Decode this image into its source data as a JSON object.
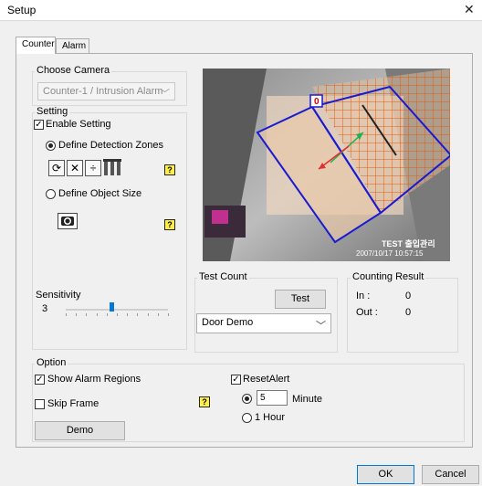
{
  "window": {
    "title": "Setup",
    "close_glyph": "✕"
  },
  "tabs": [
    {
      "label": "Counter"
    },
    {
      "label": "Alarm"
    }
  ],
  "choose_camera": {
    "legend": "Choose Camera",
    "value": "Counter-1 / Intrusion Alarm"
  },
  "setting": {
    "legend": "Setting",
    "enable_label": "Enable Setting",
    "enable_checked": true,
    "define_zones_label": "Define Detection Zones",
    "define_object_label": "Define Object Size",
    "help_glyph": "?"
  },
  "sensitivity": {
    "label": "Sensitivity",
    "value": "3",
    "level_fraction": 0.45
  },
  "video": {
    "zone_id": "0",
    "osd_label": "TEST 출입관리",
    "timestamp": "2007/10/17 10:57:15"
  },
  "test_count": {
    "legend": "Test Count",
    "button": "Test",
    "combo_value": "Door Demo"
  },
  "counting_result": {
    "legend": "Counting Result",
    "in_label": "In :",
    "in_value": "0",
    "out_label": "Out :",
    "out_value": "0"
  },
  "option": {
    "legend": "Option",
    "show_alarm_label": "Show Alarm Regions",
    "show_alarm_checked": true,
    "skip_frame_label": "Skip Frame",
    "skip_frame_checked": false,
    "demo_button": "Demo",
    "reset_alert_label": "ResetAlert",
    "reset_alert_checked": true,
    "minute_value": "5",
    "minute_label": "Minute",
    "hour_label": "1 Hour"
  },
  "footer": {
    "ok": "OK",
    "cancel": "Cancel"
  }
}
